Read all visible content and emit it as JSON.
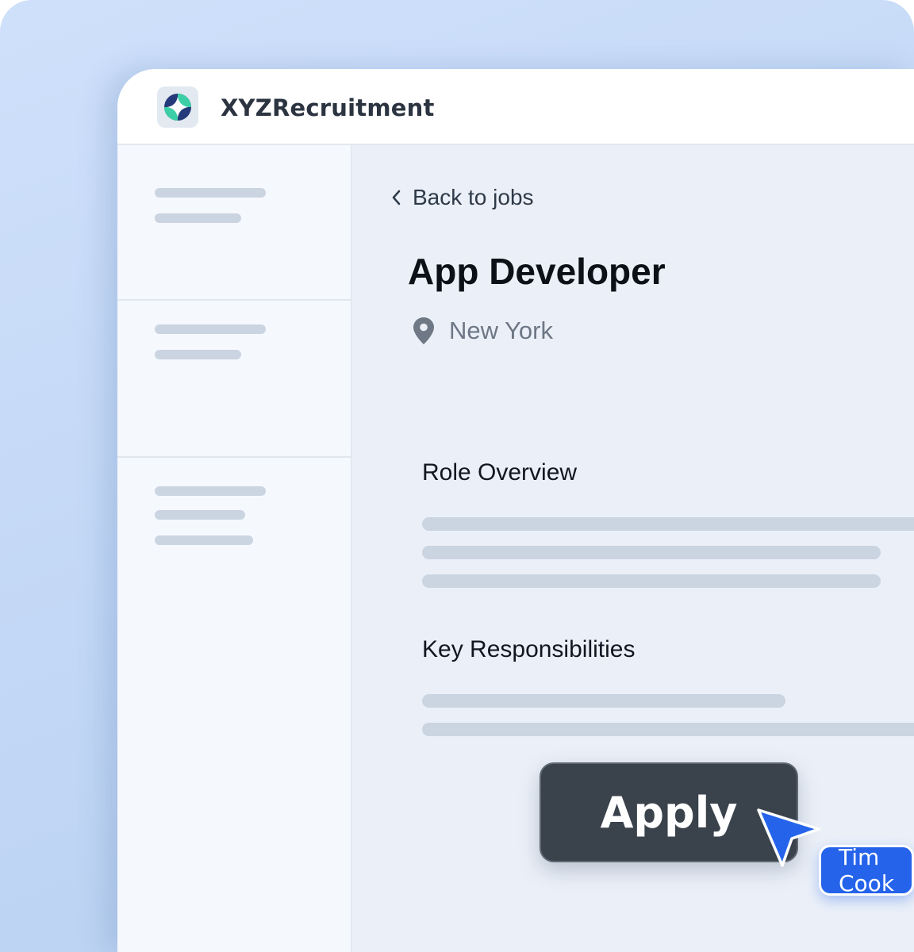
{
  "app": {
    "name": "XYZRecruitment",
    "logo_icon": "sparkle-logo-icon"
  },
  "main": {
    "back_label": "Back to jobs",
    "job_title": "App Developer",
    "location": "New York",
    "sections": [
      {
        "title": "Role Overview"
      },
      {
        "title": "Key Responsibilities"
      }
    ],
    "apply_label": "Apply"
  },
  "cursor": {
    "user_label": "Tim Cook",
    "color": "#2563eb"
  },
  "colors": {
    "accent": "#2563eb",
    "apply_bg": "#3a424c",
    "placeholder": "#cbd4e1"
  }
}
